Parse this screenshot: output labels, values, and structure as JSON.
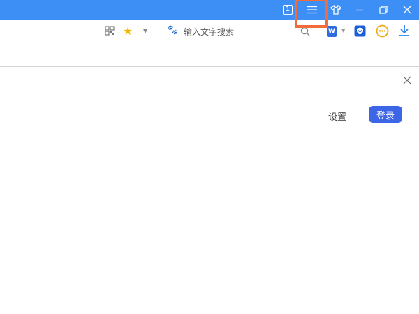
{
  "titlebar": {
    "tab_count": "1"
  },
  "toolbar": {
    "search_placeholder": "输入文字搜索",
    "word_label": "W"
  },
  "main": {
    "settings_label": "设置",
    "login_label": "登录"
  },
  "colors": {
    "titlebar": "#3d8ff5",
    "highlight": "#f26b3a",
    "login": "#3d66e6"
  }
}
